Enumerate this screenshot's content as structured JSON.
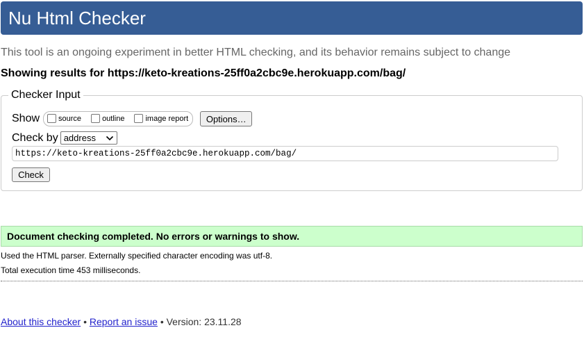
{
  "header": {
    "title": "Nu Html Checker"
  },
  "tagline": "This tool is an ongoing experiment in better HTML checking, and its behavior remains subject to change",
  "showing_results": "Showing results for https://keto-kreations-25ff0a2cbc9e.herokuapp.com/bag/",
  "checker_input": {
    "legend": "Checker Input",
    "show_label": "Show",
    "options": [
      {
        "label": "source",
        "checked": false
      },
      {
        "label": "outline",
        "checked": false
      },
      {
        "label": "image report",
        "checked": false
      }
    ],
    "options_button": "Options…",
    "check_by_label": "Check by",
    "check_by_value": "address",
    "url_value": "https://keto-kreations-25ff0a2cbc9e.herokuapp.com/bag/",
    "check_button": "Check"
  },
  "result": {
    "message": "Document checking completed. No errors or warnings to show.",
    "parser_info": "Used the HTML parser. Externally specified character encoding was utf-8.",
    "execution_time": "Total execution time 453 milliseconds."
  },
  "footer": {
    "about_link": "About this checker",
    "separator": "•",
    "report_link": "Report an issue",
    "version": "Version: 23.11.28"
  },
  "colors": {
    "title_bar": "#365d95",
    "success_bg": "#ccffcc",
    "link": "#2222cc"
  }
}
